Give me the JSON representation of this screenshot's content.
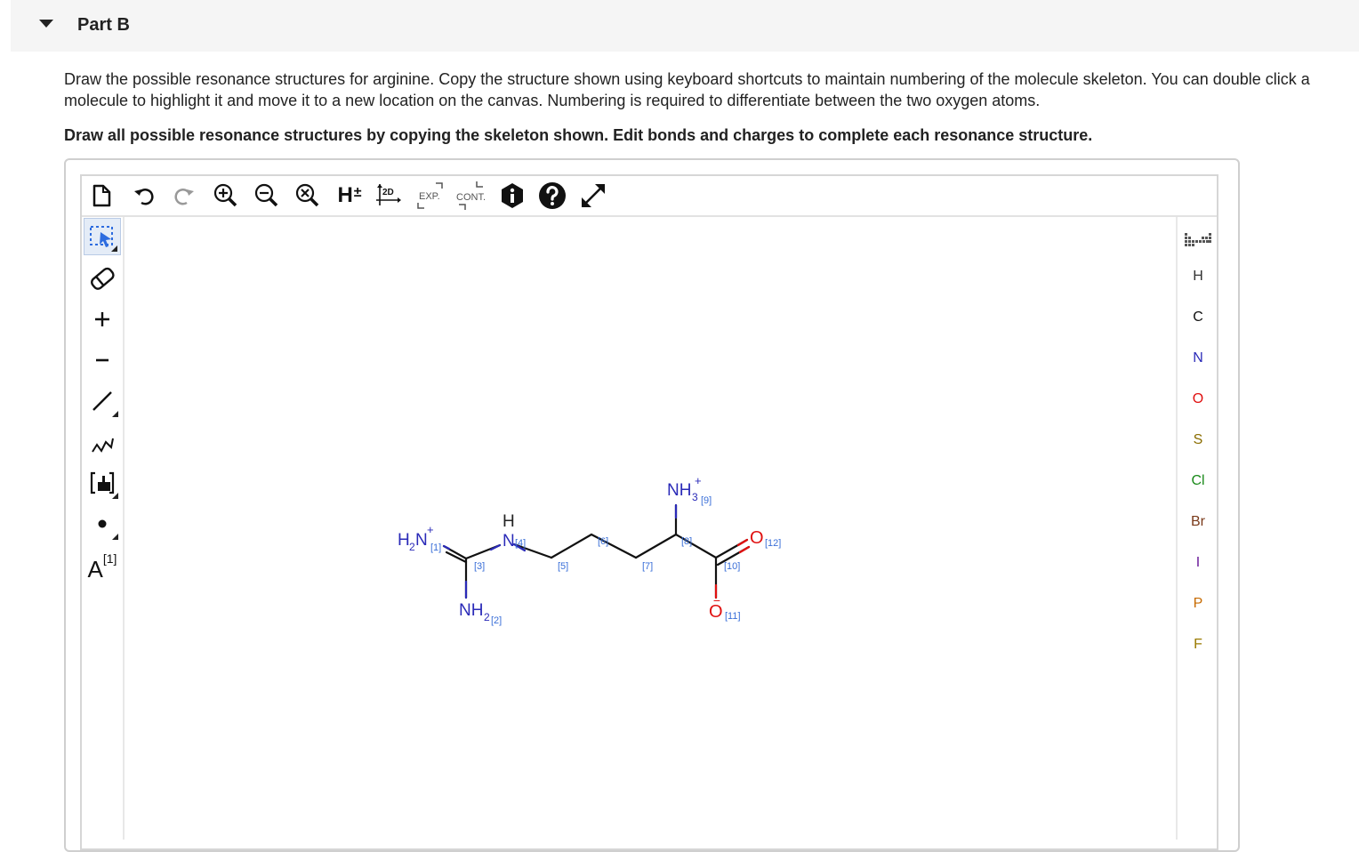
{
  "part": {
    "title": "Part B"
  },
  "instructions": {
    "text": "Draw the possible resonance structures for arginine. Copy the structure shown using keyboard shortcuts to maintain numbering of the molecule skeleton. You can double click a molecule to highlight it and move it to a new location on the canvas. Numbering is required to differentiate between the two oxygen atoms.",
    "bold": "Draw all possible resonance structures by copying the skeleton shown. Edit bonds and charges to complete each resonance structure."
  },
  "toolbar": {
    "h_label": "H",
    "h_sign": "±",
    "twod_label": "2D",
    "exp_label": "EXP.",
    "cont_label": "CONT."
  },
  "left_tools": {
    "atom_map_letter": "A",
    "atom_map_index": "[1]"
  },
  "elements": [
    {
      "symbol": "H",
      "color": "#333333"
    },
    {
      "symbol": "C",
      "color": "#111111"
    },
    {
      "symbol": "N",
      "color": "#2a2ab8"
    },
    {
      "symbol": "O",
      "color": "#e01010"
    },
    {
      "symbol": "S",
      "color": "#8a6d00"
    },
    {
      "symbol": "Cl",
      "color": "#1a8a1a"
    },
    {
      "symbol": "Br",
      "color": "#7a3a1a"
    },
    {
      "symbol": "I",
      "color": "#6a1a9a"
    },
    {
      "symbol": "P",
      "color": "#c76a00"
    },
    {
      "symbol": "F",
      "color": "#9a7a00"
    }
  ],
  "molecule": {
    "atoms": {
      "h2n": {
        "main": "H",
        "sub": "2",
        "tail": "N",
        "charge": "+",
        "map": "[1]"
      },
      "nh2": {
        "main": "NH",
        "sub": "2",
        "map": "[2]"
      },
      "c3_map": "[3]",
      "nh": {
        "h": "H",
        "n": "N",
        "map": "[4]"
      },
      "c5_map": "[5]",
      "c6_map": "[6]",
      "c7_map": "[7]",
      "c8_map": "[8]",
      "nh3": {
        "main": "NH",
        "sub": "3",
        "charge": "+",
        "map": "[9]"
      },
      "c10_map": "[10]",
      "o11": {
        "symbol": "O",
        "charge": "−",
        "map": "[11]"
      },
      "o12": {
        "symbol": "O",
        "map": "[12]"
      }
    }
  },
  "colors": {
    "nitrogen": "#2a2ab8",
    "oxygen": "#e01010",
    "map_label": "#3a6fd8",
    "bond": "#111111",
    "select_tool": "#2d6cdf"
  }
}
